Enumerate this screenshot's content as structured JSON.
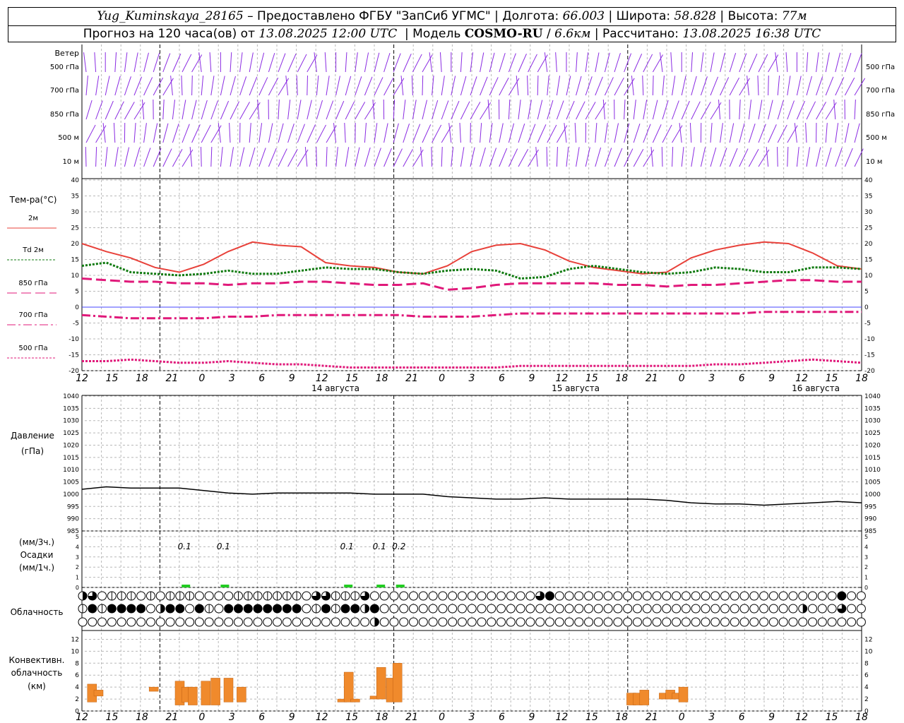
{
  "header": {
    "station": "Yug_Kuminskaya_28165",
    "dash": "–",
    "provider": "Предоставлено ФГБУ \"ЗапСиб УГМС\"",
    "lon_label": "Долгота:",
    "lon": "66.003",
    "lat_label": "Широта:",
    "lat": "58.828",
    "alt_label": "Высота:",
    "alt": "77м",
    "forecast_prefix": "Прогноз на 120 часа(ов) от",
    "forecast_time": "13.08.2025 12:00 UTC",
    "model_label": "Модель",
    "model": "COSMO-RU",
    "resolution": "6.6км",
    "calc_label": "Рассчитано:",
    "calc_time": "13.08.2025 16:38 UTC"
  },
  "chart_data": [
    {
      "type": "wind_barbs",
      "title": "Ветер",
      "levels": [
        "500 гПа",
        "700 гПа",
        "850 гПа",
        "500 м",
        "10 м"
      ],
      "color": "#8a2be2"
    },
    {
      "type": "line",
      "ylabel": "Тем-ра(°C)",
      "ylim": [
        -20,
        40
      ],
      "yticks": [
        -20,
        -15,
        -10,
        -5,
        0,
        5,
        10,
        15,
        20,
        25,
        30,
        35,
        40
      ],
      "x_hours": [
        0,
        3,
        6,
        9,
        12,
        15,
        18,
        21,
        24,
        27,
        30,
        33,
        36,
        39,
        42,
        45,
        48,
        51,
        54,
        57,
        60,
        63,
        66,
        69,
        72,
        75,
        78,
        81,
        84,
        87,
        90,
        93,
        96,
        99,
        102,
        105,
        108,
        111,
        114,
        117,
        120
      ],
      "series": [
        {
          "name": "2м",
          "color": "#e8413a",
          "style": "solid",
          "values": [
            20,
            17.5,
            15.5,
            12.5,
            11,
            13.5,
            17.5,
            20.5,
            19.5,
            19,
            14,
            13,
            12.5,
            11,
            10.5,
            13,
            17.5,
            19.5,
            20,
            18,
            14.5,
            12.5,
            11.5,
            10.5,
            11,
            15.5,
            18,
            19.5,
            20.5,
            20,
            17,
            13,
            12
          ]
        },
        {
          "name": "Td  2м",
          "color": "#0f7a0f",
          "style": "dotted",
          "values": [
            13,
            14,
            11,
            10.5,
            10,
            10.5,
            11.5,
            10.5,
            10.5,
            11.5,
            12.5,
            12,
            12,
            11,
            10.5,
            11.5,
            12,
            11.5,
            9,
            9.5,
            12,
            13,
            12,
            11,
            10.5,
            11,
            12.5,
            12,
            11,
            11,
            12.5,
            12.5,
            12
          ]
        },
        {
          "name": "850 гПа",
          "color": "#e0197a",
          "style": "longdash",
          "values": [
            9,
            8.5,
            8,
            8,
            7.5,
            7.5,
            7,
            7.5,
            7.5,
            8,
            8,
            7.5,
            7,
            7,
            7.5,
            5.5,
            6,
            7,
            7.5,
            7.5,
            7.5,
            7.5,
            7,
            7,
            6.5,
            7,
            7,
            7.5,
            8,
            8.5,
            8.5,
            8,
            8
          ]
        },
        {
          "name": "700 гПа",
          "color": "#e0197a",
          "style": "dashdot",
          "values": [
            -2.5,
            -3,
            -3.5,
            -3.5,
            -3.5,
            -3.5,
            -3,
            -3,
            -2.5,
            -2.5,
            -2.5,
            -2.5,
            -2.5,
            -2.5,
            -3,
            -3,
            -3,
            -2.5,
            -2,
            -2,
            -2,
            -2,
            -2,
            -2,
            -2,
            -2,
            -2,
            -2,
            -1.5,
            -1.5,
            -1.5,
            -1.5,
            -1.5
          ]
        },
        {
          "name": "500 гПа",
          "color": "#e0197a",
          "style": "dotted",
          "values": [
            -17,
            -17,
            -16.5,
            -17,
            -17.5,
            -17.5,
            -17,
            -17.5,
            -18,
            -18,
            -18.5,
            -19,
            -19,
            -19,
            -19,
            -19,
            -19,
            -19,
            -18.5,
            -18.5,
            -18.5,
            -18.5,
            -18.5,
            -18.5,
            -18.5,
            -18.5,
            -18,
            -18,
            -17.5,
            -17,
            -16.5,
            -17,
            -17.5
          ]
        }
      ]
    },
    {
      "type": "line",
      "ylabel": "Давление",
      "yunit": "(гПа)",
      "ylim": [
        985,
        1040
      ],
      "yticks": [
        985,
        990,
        995,
        1000,
        1005,
        1010,
        1015,
        1020,
        1025,
        1030,
        1035,
        1040
      ],
      "series": [
        {
          "name": "Давление",
          "color": "#000000",
          "values": [
            1002,
            1003,
            1002.5,
            1002.5,
            1002.5,
            1001.5,
            1000.5,
            1000,
            1000.5,
            1000.5,
            1000.5,
            1000.5,
            1000,
            1000,
            1000,
            999,
            998.5,
            998,
            998,
            998.5,
            998,
            998,
            998,
            998,
            997.5,
            996.5,
            996,
            996,
            995.5,
            996,
            996.5,
            997,
            996.5
          ]
        }
      ]
    },
    {
      "type": "bar",
      "ylabel": "Осадки",
      "units_3h": "(мм/3ч.)",
      "units_1h": "(мм/1ч.)",
      "ylim": [
        0,
        5
      ],
      "yticks": [
        0,
        1,
        2,
        3,
        4,
        5
      ],
      "color": "#22cc22",
      "events": [
        {
          "hour": 16,
          "value": 0.1,
          "label": "0.1"
        },
        {
          "hour": 22,
          "value": 0.1,
          "label": "0.1"
        },
        {
          "hour": 41,
          "value": 0.1,
          "label": "0.1"
        },
        {
          "hour": 46,
          "value": 0.1,
          "label": "0.1"
        },
        {
          "hour": 49,
          "value": 0.2,
          "label": "0.2"
        }
      ]
    },
    {
      "type": "cloud_symbols",
      "ylabel": "Облачность",
      "rows": 3
    },
    {
      "type": "bar",
      "ylabel": "Конвективн.",
      "ylabel2": "облачность",
      "yunit": "(км)",
      "ylim": [
        0,
        13
      ],
      "yticks": [
        0,
        2,
        4,
        6,
        8,
        10,
        12
      ],
      "color": "#f08a2c",
      "bars": [
        {
          "h": 1.5,
          "base": 1.5,
          "top": 4.5
        },
        {
          "h": 2.5,
          "base": 2.5,
          "top": 3.5
        },
        {
          "h": 11,
          "base": 3.3,
          "top": 4
        },
        {
          "h": 15,
          "base": 1,
          "top": 5
        },
        {
          "h": 16,
          "base": 1.5,
          "top": 4
        },
        {
          "h": 17,
          "base": 1,
          "top": 4
        },
        {
          "h": 19,
          "base": 1,
          "top": 5
        },
        {
          "h": 20.5,
          "base": 1,
          "top": 5.5
        },
        {
          "h": 22.5,
          "base": 1.5,
          "top": 5.5
        },
        {
          "h": 24.5,
          "base": 1.5,
          "top": 4
        },
        {
          "h": 40,
          "base": 1.5,
          "top": 2
        },
        {
          "h": 41,
          "base": 1.5,
          "top": 6.5
        },
        {
          "h": 42,
          "base": 1.5,
          "top": 2
        },
        {
          "h": 45,
          "base": 2,
          "top": 2.5
        },
        {
          "h": 46,
          "base": 2,
          "top": 7.3
        },
        {
          "h": 47.5,
          "base": 1.5,
          "top": 5.5
        },
        {
          "h": 48.5,
          "base": 1.5,
          "top": 8
        },
        {
          "h": 84.5,
          "base": 1,
          "top": 3
        },
        {
          "h": 85.5,
          "base": 1,
          "top": 3
        },
        {
          "h": 86.5,
          "base": 1,
          "top": 3.5
        },
        {
          "h": 89.5,
          "base": 2,
          "top": 3
        },
        {
          "h": 90.5,
          "base": 2,
          "top": 3.5
        },
        {
          "h": 91.5,
          "base": 2,
          "top": 3
        },
        {
          "h": 92.5,
          "base": 1.5,
          "top": 4
        }
      ]
    }
  ],
  "time_axis": {
    "labels": [
      "12",
      "15",
      "18",
      "21",
      "0",
      "3",
      "6",
      "9",
      "12",
      "15",
      "18",
      "21",
      "0",
      "3",
      "6",
      "9",
      "12",
      "15",
      "18",
      "21",
      "0",
      "3",
      "6",
      "9",
      "12",
      "15",
      "18"
    ],
    "date_labels": [
      "14 августа",
      "15 августа",
      "16 августа"
    ]
  },
  "legend": {
    "title": "Тем-ра(°C)",
    "items": [
      "2м",
      "Td  2м",
      "850 гПа",
      "700 гПа",
      "500 гПа"
    ]
  }
}
